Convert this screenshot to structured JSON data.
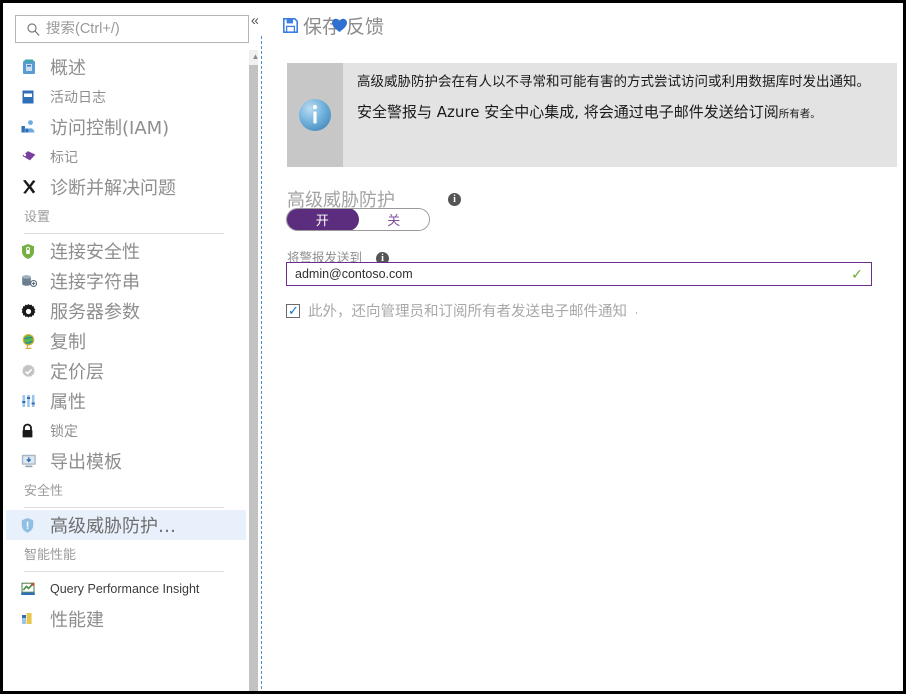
{
  "sidebar": {
    "search": {
      "placeholder": "搜索(Ctrl+/)",
      "value": "",
      "icon": "search-icon"
    },
    "collapse_icon": "«",
    "items": [
      {
        "label": "概述",
        "icon": "overview-icon",
        "size": "big",
        "type": "item"
      },
      {
        "label": "活动日志",
        "icon": "activity-log-icon",
        "size": "mid",
        "type": "item"
      },
      {
        "label": "访问控制(IAM)",
        "icon": "access-control-icon",
        "size": "big",
        "type": "item"
      },
      {
        "label": "标记",
        "icon": "tag-icon",
        "size": "mid",
        "type": "item"
      },
      {
        "label": "诊断并解决问题",
        "icon": "diagnose-icon",
        "size": "big",
        "type": "item"
      },
      {
        "label": "设置",
        "type": "group"
      },
      {
        "label": "连接安全性",
        "icon": "connection-security-shield-icon",
        "size": "big",
        "type": "item"
      },
      {
        "label": "连接字符串",
        "icon": "connection-string-icon",
        "size": "big",
        "type": "item"
      },
      {
        "label": "服务器参数",
        "icon": "gear-icon",
        "size": "big",
        "type": "item"
      },
      {
        "label": "复制",
        "icon": "globe-icon",
        "size": "big",
        "type": "item"
      },
      {
        "label": "定价层",
        "icon": "pricing-tier-icon",
        "size": "big",
        "type": "item"
      },
      {
        "label": "属性",
        "icon": "properties-sliders-icon",
        "size": "big",
        "type": "item"
      },
      {
        "label": "锁定",
        "icon": "lock-icon",
        "size": "mid",
        "type": "item"
      },
      {
        "label": "导出模板",
        "icon": "export-template-icon",
        "size": "big",
        "type": "item"
      },
      {
        "label": "安全性",
        "type": "group"
      },
      {
        "label": "高级威胁防护…",
        "icon": "advanced-threat-protection-shield-icon",
        "size": "sel",
        "type": "item",
        "selected": true
      },
      {
        "label": "智能性能",
        "type": "group"
      },
      {
        "label": "Query Performance Insight",
        "icon": "query-performance-insight-icon",
        "size": "latin",
        "type": "item"
      },
      {
        "label": "性能建",
        "icon": "performance-recommendation-icon",
        "size": "big",
        "type": "item"
      }
    ],
    "scrollbar": {
      "up_arrow": "▲"
    }
  },
  "toolbar": {
    "save_label": "保存",
    "save_icon": "save-floppy-icon",
    "feedback_label": "反馈",
    "feedback_icon": "feedback-heart-icon"
  },
  "banner": {
    "icon": "info-circle-icon",
    "paragraph1": "高级威胁防护会在有人以不寻常和可能有害的方式尝试访问或利用数据库时发出通知。",
    "paragraph2_main": "安全警报与 Azure 安全中心集成, 将会通过电子邮件发送给订阅",
    "paragraph2_tail": "所有者。"
  },
  "form": {
    "atp_label": "高级威胁防护",
    "atp_info_icon": "info-icon",
    "toggle": {
      "on_label": "开",
      "off_label": "关",
      "selected": "开"
    },
    "email_label": "将警报发送到",
    "email_info_icon": "info-icon",
    "email_value": "admin@contoso.com",
    "email_placeholder": "",
    "email_valid_icon": "checkmark-icon",
    "checkbox_label": "此外，还向管理员和订阅所有者发送电子邮件通知",
    "checkbox_trailing": ",",
    "checkbox_checked": true
  },
  "colors": {
    "accent_purple": "#5c2d7e",
    "link_blue": "#3d7ee0",
    "valid_green": "#6aa82b",
    "selected_row": "#e8f1fb",
    "banner_bg": "#e3e3e3",
    "guide_dash": "#4a90d9"
  }
}
